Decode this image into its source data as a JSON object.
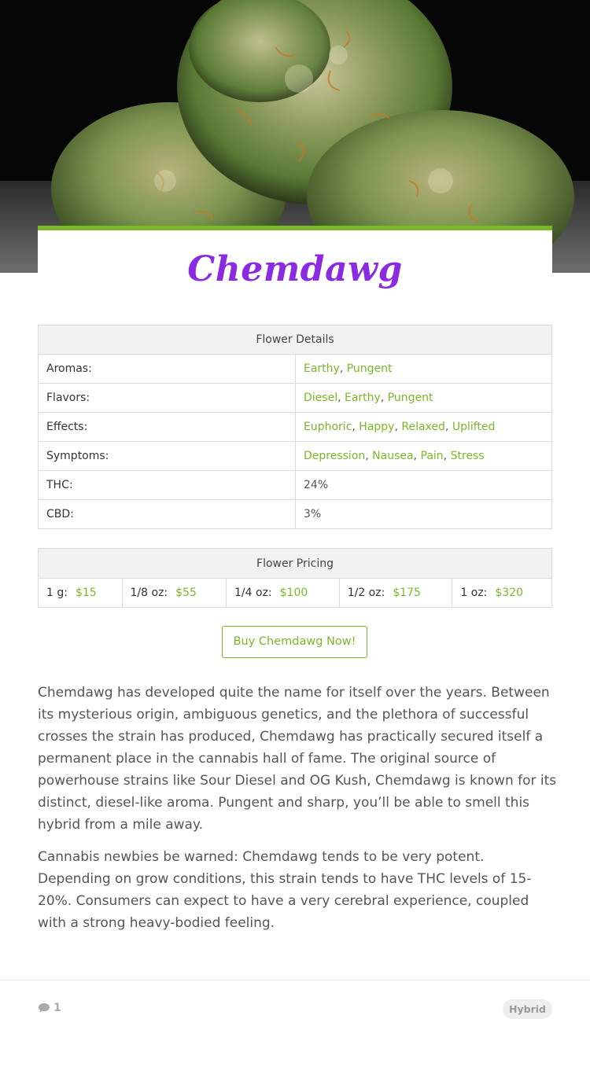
{
  "strain": {
    "name": "Chemdawg",
    "hero_image": "cannabis-bud-photo"
  },
  "details": {
    "header": "Flower Details",
    "rows": [
      {
        "label": "Aromas:",
        "values": [
          "Earthy",
          "Pungent"
        ],
        "linked": true
      },
      {
        "label": "Flavors:",
        "values": [
          "Diesel",
          "Earthy",
          "Pungent"
        ],
        "linked": true
      },
      {
        "label": "Effects:",
        "values": [
          "Euphoric",
          "Happy",
          "Relaxed",
          "Uplifted"
        ],
        "linked": true
      },
      {
        "label": "Symptoms:",
        "values": [
          "Depression",
          "Nausea",
          "Pain",
          "Stress"
        ],
        "linked": true
      },
      {
        "label": "THC:",
        "values": [
          "24%"
        ],
        "linked": false
      },
      {
        "label": "CBD:",
        "values": [
          "3%"
        ],
        "linked": false
      }
    ]
  },
  "pricing": {
    "header": "Flower Pricing",
    "items": [
      {
        "unit": "1 g:",
        "price": "$15"
      },
      {
        "unit": "1/8 oz:",
        "price": "$55"
      },
      {
        "unit": "1/4 oz:",
        "price": "$100"
      },
      {
        "unit": "1/2 oz:",
        "price": "$175"
      },
      {
        "unit": "1 oz:",
        "price": "$320"
      }
    ]
  },
  "buy_button": {
    "label": "Buy Chemdawg Now!"
  },
  "description": [
    "Chemdawg has developed quite the name for itself over the years. Between its mysterious origin, ambiguous genetics, and the plethora of successful crosses the strain has produced, Chemdawg has practically secured itself a permanent place in the cannabis hall of fame. The original source of powerhouse strains like Sour Diesel and OG Kush, Chemdawg is known for its distinct, diesel-like aroma. Pungent and sharp, you’ll be able to smell this hybrid from a mile away.",
    "Cannabis newbies be warned: Chemdawg tends to be very potent. Depending on grow conditions, this strain tends to have THC levels of 15-20%. Consumers can expect to have a very cerebral experience, coupled with a strong heavy-bodied feeling."
  ],
  "footer": {
    "comment_count": "1",
    "comment_icon": "speech-bubble-icon",
    "tag": "Hybrid"
  },
  "colors": {
    "accent_green": "#7ab828",
    "title_purple": "#8a2be2"
  }
}
